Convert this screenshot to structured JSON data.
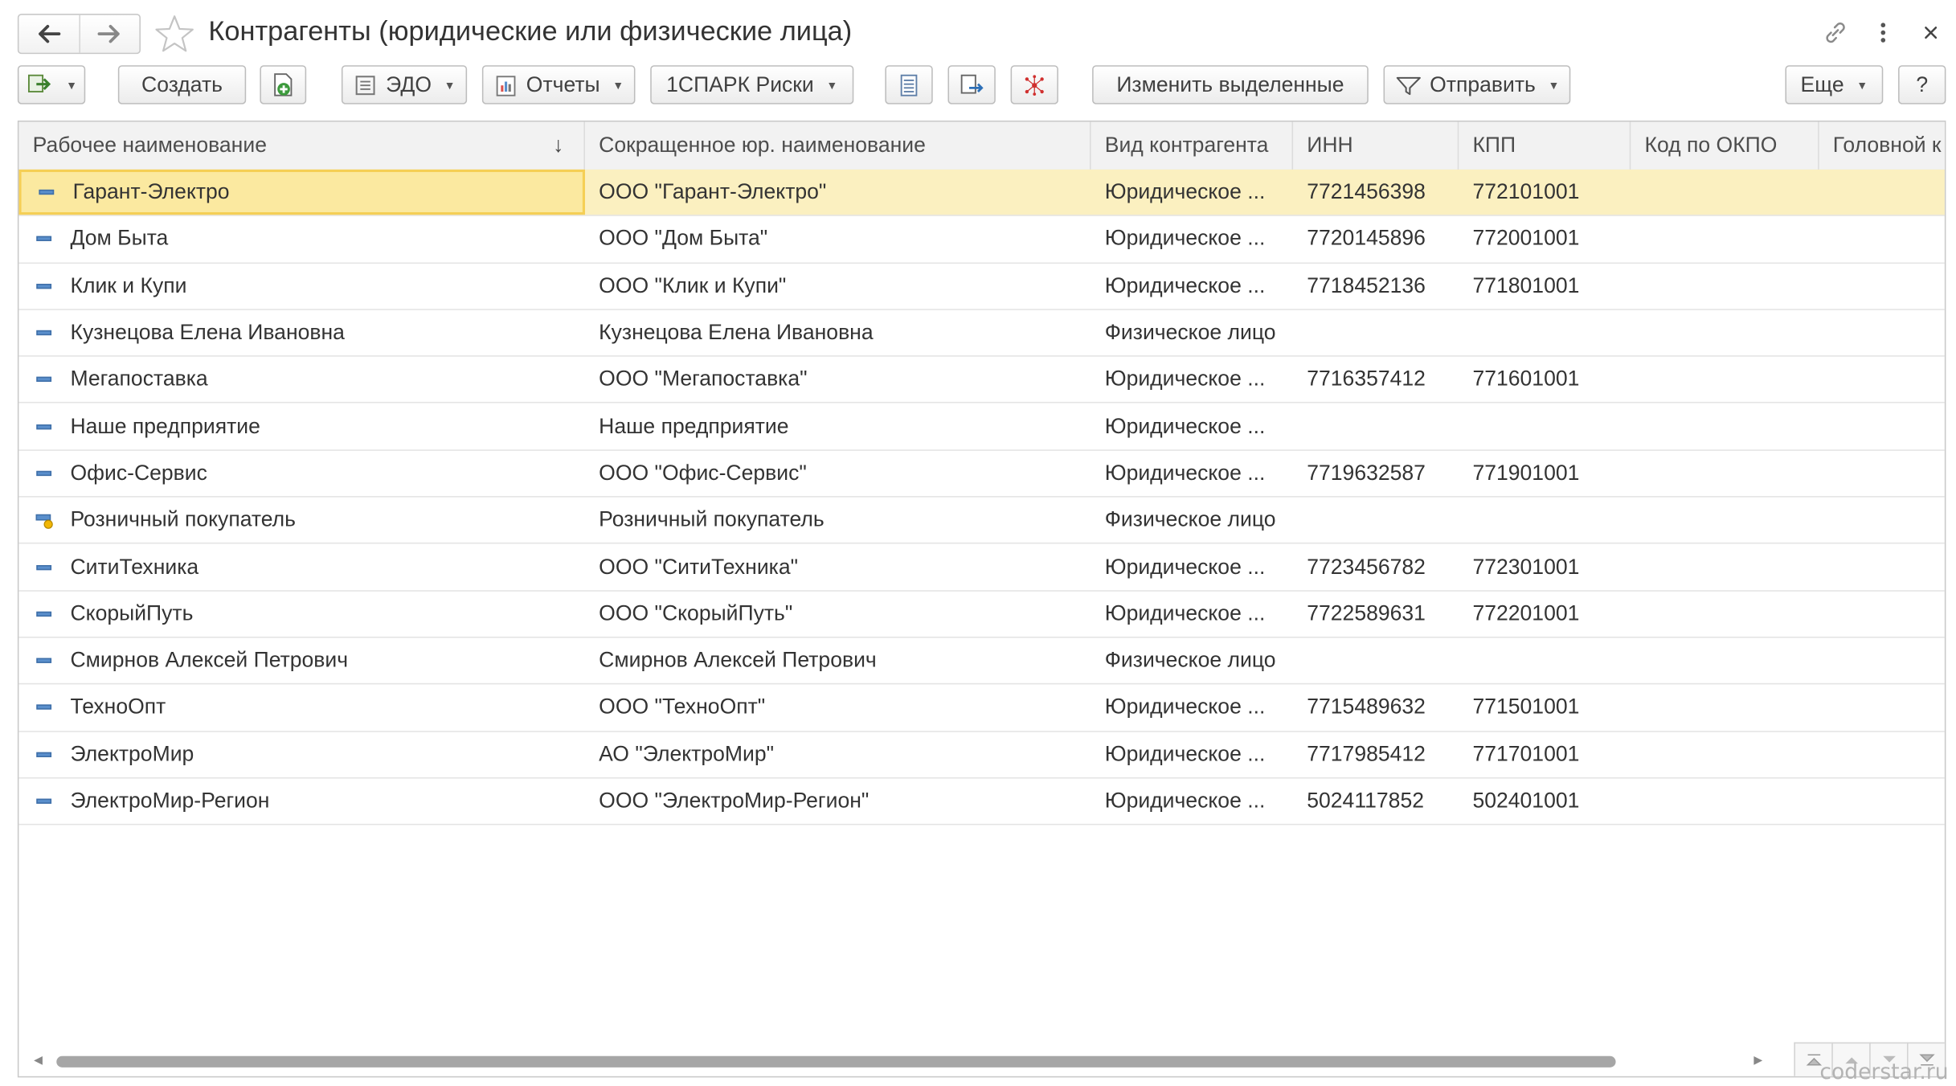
{
  "window": {
    "title": "Контрагенты (юридические или физические лица)"
  },
  "toolbar": {
    "create_label": "Создать",
    "edo_label": "ЭДО",
    "reports_label": "Отчеты",
    "spark_label": "1СПАРК Риски",
    "edit_selected_label": "Изменить выделенные",
    "send_label": "Отправить",
    "more_label": "Еще",
    "help_label": "?"
  },
  "table": {
    "columns": [
      "Рабочее наименование",
      "Сокращенное юр. наименование",
      "Вид контрагента",
      "ИНН",
      "КПП",
      "Код по ОКПО",
      "Головной к"
    ],
    "sort_indicator": "↓",
    "rows": [
      {
        "name": "Гарант-Электро",
        "short": "ООО \"Гарант-Электро\"",
        "kind": "Юридическое ...",
        "inn": "7721456398",
        "kpp": "772101001",
        "icon": "dash-icon"
      },
      {
        "name": "Дом Быта",
        "short": "ООО \"Дом Быта\"",
        "kind": "Юридическое ...",
        "inn": "7720145896",
        "kpp": "772001001",
        "icon": "dash-icon"
      },
      {
        "name": "Клик и Купи",
        "short": "ООО \"Клик и Купи\"",
        "kind": "Юридическое ...",
        "inn": "7718452136",
        "kpp": "771801001",
        "icon": "dash-icon"
      },
      {
        "name": "Кузнецова Елена Ивановна",
        "short": "Кузнецова Елена Ивановна",
        "kind": "Физическое лицо",
        "inn": "",
        "kpp": "",
        "icon": "dash-icon"
      },
      {
        "name": "Мегапоставка",
        "short": "ООО \"Мегапоставка\"",
        "kind": "Юридическое ...",
        "inn": "7716357412",
        "kpp": "771601001",
        "icon": "dash-icon"
      },
      {
        "name": "Наше предприятие",
        "short": "Наше предприятие",
        "kind": "Юридическое ...",
        "inn": "",
        "kpp": "",
        "icon": "dash-icon"
      },
      {
        "name": "Офис-Сервис",
        "short": "ООО \"Офис-Сервис\"",
        "kind": "Юридическое ...",
        "inn": "7719632587",
        "kpp": "771901001",
        "icon": "dash-icon"
      },
      {
        "name": "Розничный покупатель",
        "short": "Розничный покупатель",
        "kind": "Физическое лицо",
        "inn": "",
        "kpp": "",
        "icon": "predefined-item-icon"
      },
      {
        "name": "СитиТехника",
        "short": "ООО \"СитиТехника\"",
        "kind": "Юридическое ...",
        "inn": "7723456782",
        "kpp": "772301001",
        "icon": "dash-icon"
      },
      {
        "name": "СкорыйПуть",
        "short": "ООО \"СкорыйПуть\"",
        "kind": "Юридическое ...",
        "inn": "7722589631",
        "kpp": "772201001",
        "icon": "dash-icon"
      },
      {
        "name": "Смирнов Алексей Петрович",
        "short": "Смирнов Алексей Петрович",
        "kind": "Физическое лицо",
        "inn": "",
        "kpp": "",
        "icon": "dash-icon"
      },
      {
        "name": "ТехноОпт",
        "short": "ООО \"ТехноОпт\"",
        "kind": "Юридическое ...",
        "inn": "7715489632",
        "kpp": "771501001",
        "icon": "dash-icon"
      },
      {
        "name": "ЭлектроМир",
        "short": "АО \"ЭлектроМир\"",
        "kind": "Юридическое ...",
        "inn": "7717985412",
        "kpp": "771701001",
        "icon": "dash-icon"
      },
      {
        "name": "ЭлектроМир-Регион",
        "short": "ООО \"ЭлектроМир-Регион\"",
        "kind": "Юридическое ...",
        "inn": "5024117852",
        "kpp": "502401001",
        "icon": "dash-icon"
      }
    ],
    "selected_row": 0
  },
  "watermark": "coderstar.ru",
  "colors": {
    "selected_row": "#fbf0c0",
    "selected_cell_border": "#f5cf55",
    "header_bg": "#f2f2f2"
  }
}
